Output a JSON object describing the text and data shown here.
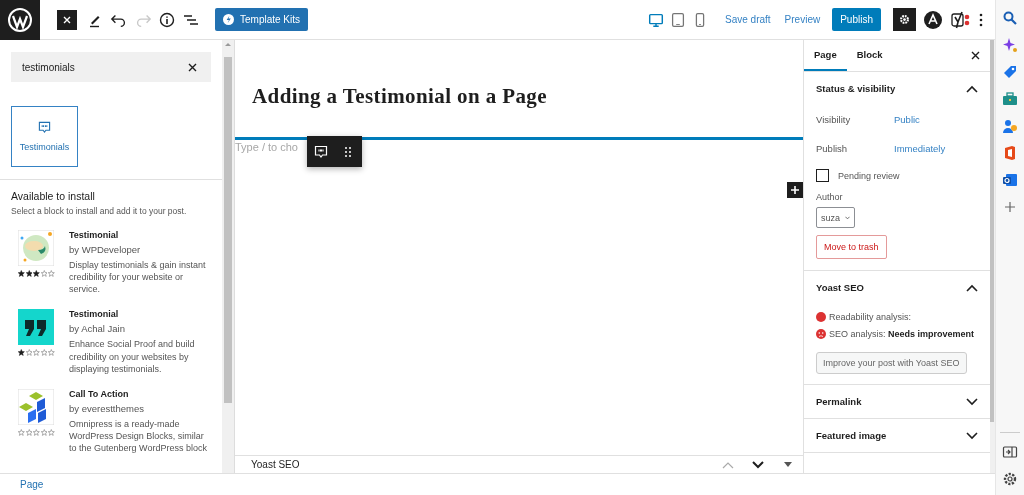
{
  "topbar": {
    "history": [
      {
        "kind": "undo",
        "disabled": false
      },
      {
        "kind": "redo",
        "disabled": true
      }
    ],
    "template_kits": "Template Kits",
    "devices": [
      {
        "kind": "desktop",
        "selected": true
      },
      {
        "kind": "tablet",
        "selected": false
      },
      {
        "kind": "mobile",
        "selected": false
      }
    ],
    "save_draft": "Save draft",
    "preview": "Preview",
    "publish": "Publish"
  },
  "inserter": {
    "search": {
      "value": "testimonials"
    },
    "blocks": [
      {
        "label": "Testimonials",
        "selected": true
      }
    ],
    "install": {
      "title": "Available to install",
      "description": "Select a block to install and add it to your post.",
      "items": [
        {
          "kind": "speech",
          "name": "Testimonial",
          "author": "by WPDeveloper",
          "description": "Display testimonials & gain instant credibility for your website or service.",
          "stars": 3
        },
        {
          "kind": "quote",
          "name": "Testimonial",
          "author": "by Achal Jain",
          "description": "Enhance Social Proof and build credibility on your websites by displaying testimonials.",
          "stars": 1
        },
        {
          "kind": "cubes",
          "name": "Call To Action",
          "author": "by everestthemes",
          "description": "Omnipress is a ready-made WordPress Design Blocks, similar to the Gutenberg WordPress block",
          "stars": 0
        }
      ]
    }
  },
  "editor": {
    "title": "Adding a Testimonial on a Page",
    "placeholder": "Type / to cho",
    "metabox": {
      "title": "Yoast SEO",
      "arrows": [
        {
          "kind": "up",
          "disabled": true
        },
        {
          "kind": "down",
          "disabled": false
        }
      ]
    }
  },
  "sidebar": {
    "tabs": [
      {
        "label": "Page",
        "selected": true
      },
      {
        "label": "Block",
        "selected": false
      }
    ],
    "panels": [
      {
        "kind": "status",
        "title": "Status & visibility",
        "expanded": true,
        "rows": [
          {
            "label": "Visibility",
            "value": "Public"
          },
          {
            "label": "Publish",
            "value": "Immediately"
          }
        ],
        "pending_review": {
          "label": "Pending review",
          "checked": false
        },
        "author": {
          "label": "Author",
          "value": "suza"
        },
        "trash": "Move to trash"
      },
      {
        "kind": "yoast",
        "title": "Yoast SEO",
        "expanded": true,
        "analyses": [
          {
            "kind": "dot",
            "text": "Readability analysis:",
            "color": "#dc3232"
          },
          {
            "kind": "face",
            "text": "SEO analysis: **Needs improvement**",
            "color": "#dc3232"
          }
        ],
        "button": "Improve your post with Yoast SEO"
      },
      {
        "kind": "plain",
        "title": "Permalink",
        "expanded": false
      },
      {
        "kind": "plain",
        "title": "Featured image",
        "expanded": false
      }
    ]
  },
  "footer": {
    "breadcrumb": "Page"
  }
}
